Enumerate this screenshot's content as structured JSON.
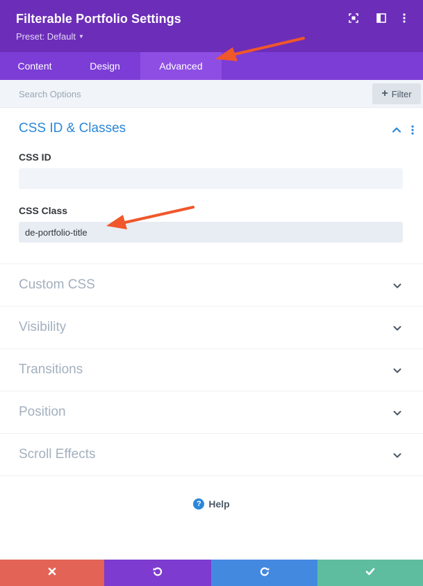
{
  "header": {
    "title": "Filterable Portfolio Settings",
    "preset_label": "Preset: Default",
    "icons": [
      "expand-icon",
      "split-view-icon",
      "more-vertical-icon"
    ]
  },
  "tabs": [
    {
      "label": "Content",
      "active": false
    },
    {
      "label": "Design",
      "active": false
    },
    {
      "label": "Advanced",
      "active": true
    }
  ],
  "search": {
    "placeholder": "Search Options",
    "filter_label": "Filter"
  },
  "sections": {
    "open": {
      "title": "CSS ID & Classes",
      "fields": [
        {
          "label": "CSS ID",
          "value": ""
        },
        {
          "label": "CSS Class",
          "value": "de-portfolio-title"
        }
      ]
    },
    "collapsed": [
      {
        "title": "Custom CSS"
      },
      {
        "title": "Visibility"
      },
      {
        "title": "Transitions"
      },
      {
        "title": "Position"
      },
      {
        "title": "Scroll Effects"
      }
    ]
  },
  "help": {
    "label": "Help",
    "icon_glyph": "?"
  },
  "footer": {
    "buttons": [
      {
        "name": "cancel",
        "icon": "close-icon",
        "color": "#e36456"
      },
      {
        "name": "undo",
        "icon": "undo-icon",
        "color": "#7d3bcf"
      },
      {
        "name": "redo",
        "icon": "redo-icon",
        "color": "#4489e0"
      },
      {
        "name": "save",
        "icon": "check-icon",
        "color": "#5ebd9f"
      }
    ]
  },
  "colors": {
    "header_bg": "#6c2eb9",
    "tabs_bg": "#7b3dd6",
    "active_tab_bg": "#8e4ee4",
    "accent_blue": "#2b87da",
    "annotation_arrow": "#f0572a"
  }
}
